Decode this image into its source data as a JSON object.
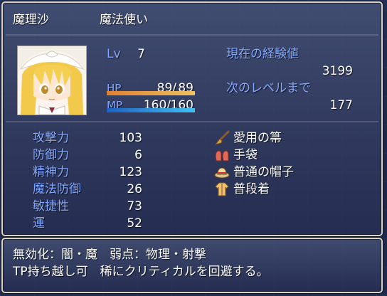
{
  "actor": {
    "name": "魔理沙",
    "class": "魔法使い",
    "level_label": "Lv",
    "level": "7",
    "hp_label": "HP",
    "hp_current": "89/",
    "hp_max": "89",
    "hp_ratio": 1.0,
    "mp_label": "MP",
    "mp_current": "160/",
    "mp_max": "160",
    "mp_ratio": 1.0
  },
  "exp": {
    "current_label": "現在の経験値",
    "current_value": "3199",
    "next_label": "次のレベルまで",
    "next_value": "177"
  },
  "params": [
    {
      "label": "攻撃力",
      "value": "103"
    },
    {
      "label": "防御力",
      "value": "6"
    },
    {
      "label": "精神力",
      "value": "123"
    },
    {
      "label": "魔法防御",
      "value": "26"
    },
    {
      "label": "敏捷性",
      "value": "73"
    },
    {
      "label": "運",
      "value": "52"
    }
  ],
  "equipment": [
    {
      "icon": "broom-icon",
      "name": "愛用の箒"
    },
    {
      "icon": "gloves-icon",
      "name": "手袋"
    },
    {
      "icon": "hat-icon",
      "name": "普通の帽子"
    },
    {
      "icon": "clothes-icon",
      "name": "普段着"
    }
  ],
  "description": {
    "line1": "無効化：闇・魔　弱点：物理・射撃",
    "line2": "TP持ち越し可　稀にクリティカルを回避する。"
  },
  "colors": {
    "system": "#84a8ff",
    "hp_gauge": "#e08030",
    "mp_gauge": "#40c0f0",
    "window_border": "#d9d2c4"
  }
}
